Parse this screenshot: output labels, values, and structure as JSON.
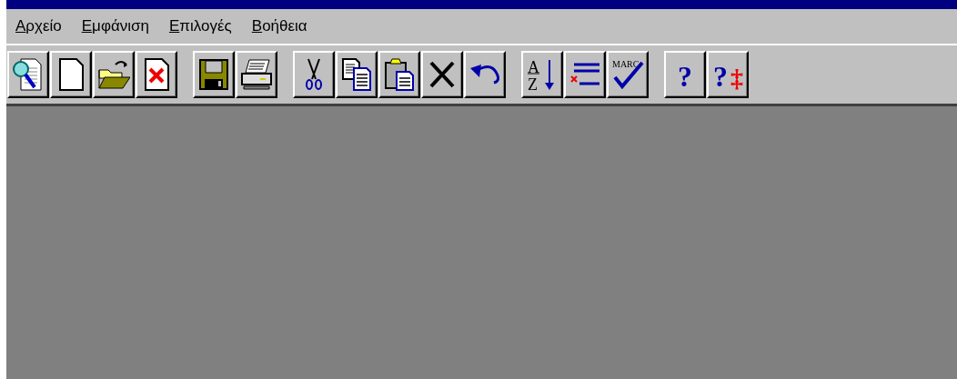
{
  "menu": [
    {
      "label": "Αρχείο"
    },
    {
      "label": "Εμφάνιση"
    },
    {
      "label": "Επιλογές"
    },
    {
      "label": "Βοήθεια"
    }
  ],
  "toolbar": [
    [
      {
        "kind": "find"
      },
      {
        "kind": "new"
      },
      {
        "kind": "open"
      },
      {
        "kind": "close"
      }
    ],
    [
      {
        "kind": "save"
      },
      {
        "kind": "print"
      }
    ],
    [
      {
        "kind": "cut"
      },
      {
        "kind": "copy"
      },
      {
        "kind": "paste"
      },
      {
        "kind": "delete"
      },
      {
        "kind": "undo"
      }
    ],
    [
      {
        "kind": "sort",
        "texts": [
          "A",
          "Z"
        ]
      },
      {
        "kind": "list"
      },
      {
        "kind": "marc",
        "texts": [
          "MARC"
        ]
      }
    ],
    [
      {
        "kind": "help",
        "texts": [
          "?"
        ]
      },
      {
        "kind": "help-mark",
        "texts": [
          "?",
          "‡"
        ]
      }
    ]
  ]
}
